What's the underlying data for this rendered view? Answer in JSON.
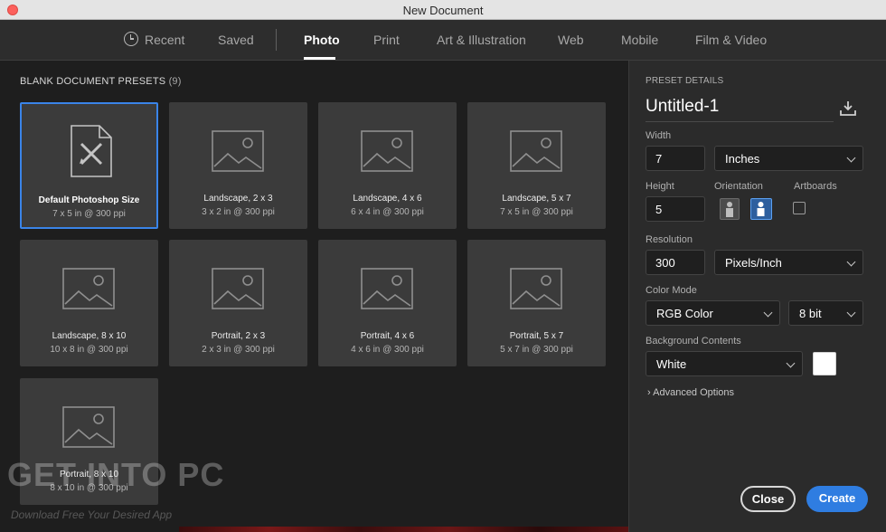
{
  "window": {
    "title": "New Document"
  },
  "tabs": [
    {
      "label": "Recent"
    },
    {
      "label": "Saved"
    },
    {
      "label": "Photo"
    },
    {
      "label": "Print"
    },
    {
      "label": "Art & Illustration"
    },
    {
      "label": "Web"
    },
    {
      "label": "Mobile"
    },
    {
      "label": "Film & Video"
    }
  ],
  "presets": {
    "title": "BLANK DOCUMENT PRESETS",
    "count": "(9)",
    "items": [
      {
        "name": "Default Photoshop Size",
        "dims": "7 x 5 in @ 300 ppi",
        "icon": "document-brush-icon"
      },
      {
        "name": "Landscape, 2 x 3",
        "dims": "3 x 2 in @ 300 ppi",
        "icon": "image-icon"
      },
      {
        "name": "Landscape, 4 x 6",
        "dims": "6 x 4 in @ 300 ppi",
        "icon": "image-icon"
      },
      {
        "name": "Landscape, 5 x 7",
        "dims": "7 x 5 in @ 300 ppi",
        "icon": "image-icon"
      },
      {
        "name": "Landscape, 8 x 10",
        "dims": "10 x 8 in @ 300 ppi",
        "icon": "image-icon"
      },
      {
        "name": "Portrait, 2 x 3",
        "dims": "2 x 3 in @ 300 ppi",
        "icon": "image-icon"
      },
      {
        "name": "Portrait, 4 x 6",
        "dims": "4 x 6 in @ 300 ppi",
        "icon": "image-icon"
      },
      {
        "name": "Portrait, 5 x 7",
        "dims": "5 x 7 in @ 300 ppi",
        "icon": "image-icon"
      },
      {
        "name": "Portrait, 8 x 10",
        "dims": "8 x 10 in @ 300 ppi",
        "icon": "image-icon"
      }
    ]
  },
  "details": {
    "title": "PRESET DETAILS",
    "doc_name": "Untitled-1",
    "width_label": "Width",
    "width_value": "7",
    "width_unit": "Inches",
    "height_label": "Height",
    "height_value": "5",
    "orientation_label": "Orientation",
    "artboards_label": "Artboards",
    "resolution_label": "Resolution",
    "resolution_value": "300",
    "resolution_unit": "Pixels/Inch",
    "color_mode_label": "Color Mode",
    "color_mode": "RGB Color",
    "bit_depth": "8 bit",
    "bg_label": "Background Contents",
    "bg_value": "White",
    "bg_swatch": "#ffffff",
    "advanced": "Advanced Options"
  },
  "buttons": {
    "close": "Close",
    "create": "Create"
  },
  "watermark": {
    "main": "GET INTO PC",
    "sub": "Download Free Your Desired App"
  },
  "colors": {
    "accent": "#2f7de1",
    "selection": "#3a84e8"
  }
}
